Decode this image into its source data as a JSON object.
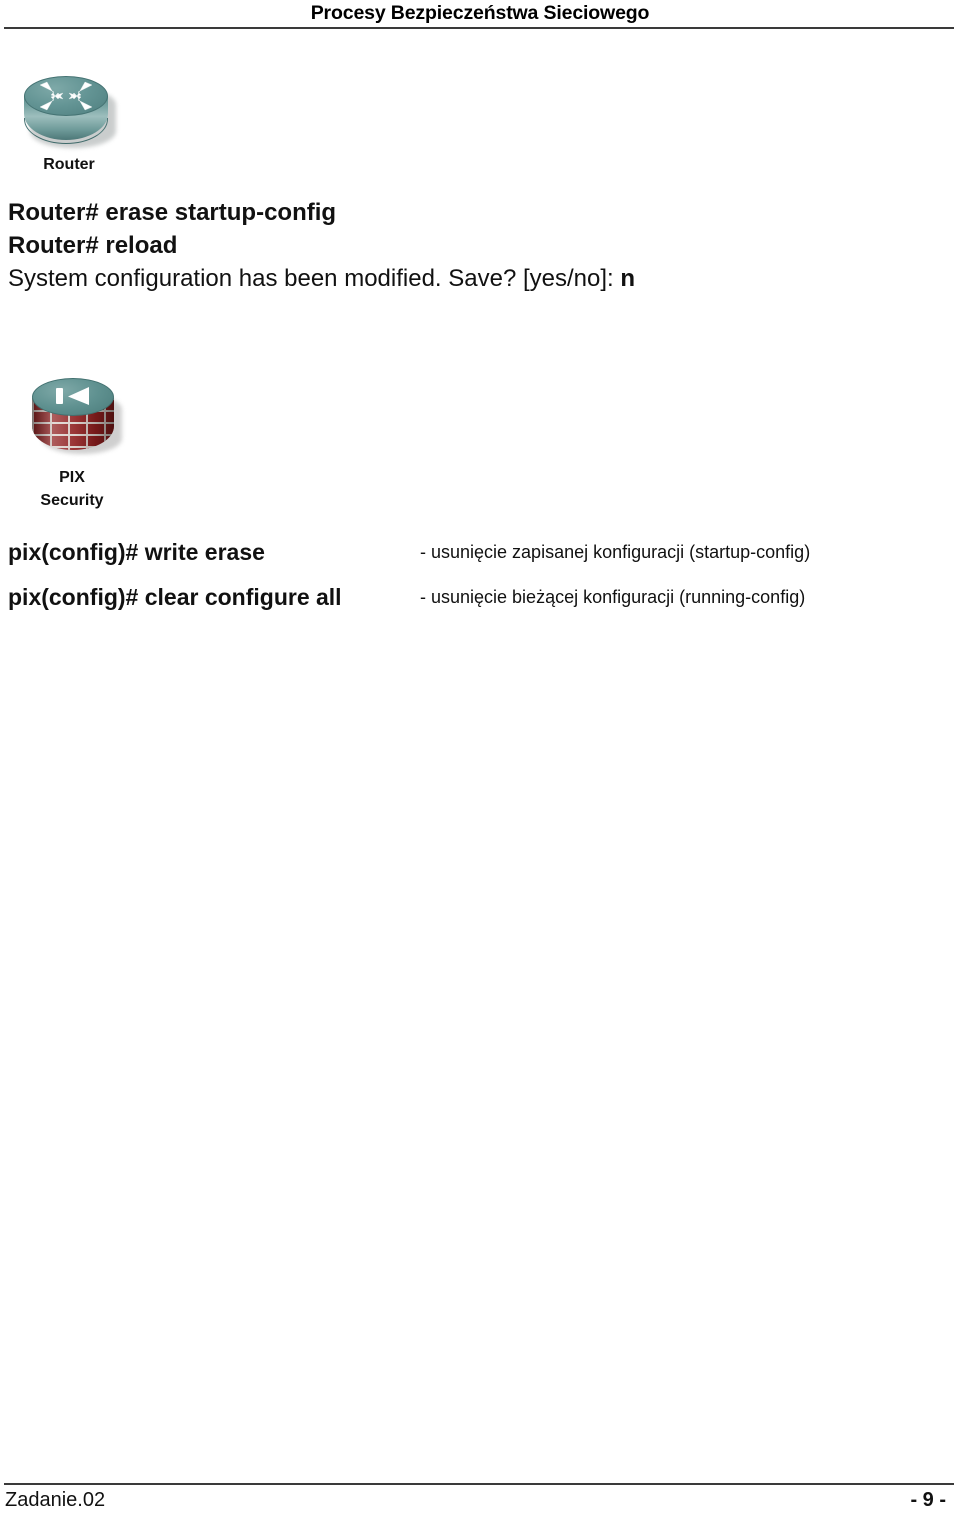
{
  "header": {
    "title": "Procesy Bezpieczeństwa Sieciowego"
  },
  "router_figure": {
    "icon_name": "cisco-router-icon",
    "caption": "Router",
    "colors": {
      "body": "#6f9b9a",
      "top": "#639494",
      "arrow": "#ffffff"
    }
  },
  "router_cli": {
    "line1": "Router# erase startup-config",
    "line2": "Router# reload",
    "line3_prefix": "System configuration has been modified. Save? [yes/no]: ",
    "line3_answer": "n"
  },
  "pix_figure": {
    "icon_name": "cisco-pix-firewall-icon",
    "caption_line1": "PIX",
    "caption_line2": "Security",
    "colors": {
      "brick": "#8e1e1e",
      "mortar": "#d9cfc9",
      "top": "#5f9190"
    }
  },
  "pix_commands": [
    {
      "command": "pix(config)# write erase",
      "description": "- usunięcie zapisanej konfiguracji (startup-config)"
    },
    {
      "command": "pix(config)# clear configure all",
      "description": "- usunięcie bieżącej konfiguracji (running-config)"
    }
  ],
  "footer": {
    "left": "Zadanie.02",
    "right": "- 9 -"
  }
}
